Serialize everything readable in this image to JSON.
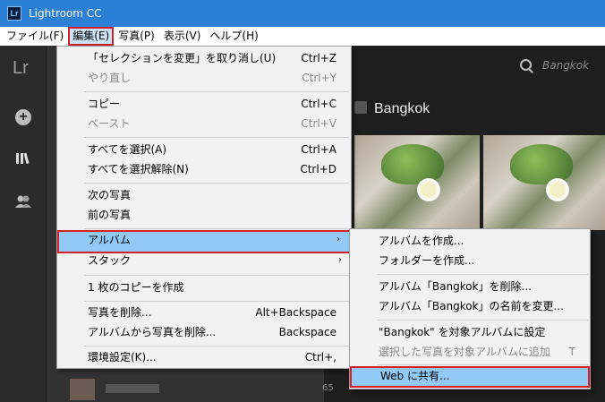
{
  "window": {
    "title": "Lightroom CC",
    "icon_text": "Lr"
  },
  "menubar": {
    "items": [
      "ファイル(F)",
      "編集(E)",
      "写真(P)",
      "表示(V)",
      "ヘルプ(H)"
    ]
  },
  "app": {
    "logo": "Lr",
    "search_text": "Bangkok",
    "album_title": "Bangkok",
    "album_row_count": "65"
  },
  "edit_menu": {
    "items": [
      {
        "label": "「セレクションを変更」を取り消し(U)",
        "shortcut": "Ctrl+Z"
      },
      {
        "label": "やり直し",
        "shortcut": "Ctrl+Y"
      },
      {
        "label": "コピー",
        "shortcut": "Ctrl+C"
      },
      {
        "label": "ペースト",
        "shortcut": "Ctrl+V"
      },
      {
        "label": "すべてを選択(A)",
        "shortcut": "Ctrl+A"
      },
      {
        "label": "すべてを選択解除(N)",
        "shortcut": "Ctrl+D"
      },
      {
        "label": "次の写真",
        "shortcut": ""
      },
      {
        "label": "前の写真",
        "shortcut": ""
      },
      {
        "label": "アルバム",
        "shortcut": ""
      },
      {
        "label": "スタック",
        "shortcut": ""
      },
      {
        "label": "1 枚のコピーを作成",
        "shortcut": ""
      },
      {
        "label": "写真を削除...",
        "shortcut": "Alt+Backspace"
      },
      {
        "label": "アルバムから写真を削除...",
        "shortcut": "Backspace"
      },
      {
        "label": "環境設定(K)...",
        "shortcut": "Ctrl+,"
      }
    ]
  },
  "album_submenu": {
    "items": [
      {
        "label": "アルバムを作成...",
        "shortcut": ""
      },
      {
        "label": "フォルダーを作成...",
        "shortcut": ""
      },
      {
        "label": "アルバム「Bangkok」を削除...",
        "shortcut": ""
      },
      {
        "label": "アルバム「Bangkok」の名前を変更...",
        "shortcut": ""
      },
      {
        "label": "\"Bangkok\" を対象アルバムに設定",
        "shortcut": ""
      },
      {
        "label": "選択した写真を対象アルバムに追加",
        "shortcut": "T"
      },
      {
        "label": "Web に共有...",
        "shortcut": ""
      }
    ]
  },
  "colors": {
    "titlebar": "#2b7fd4",
    "highlight": "#91c9f7",
    "outline": "#d4202a",
    "app_bg": "#1e1e1e"
  }
}
